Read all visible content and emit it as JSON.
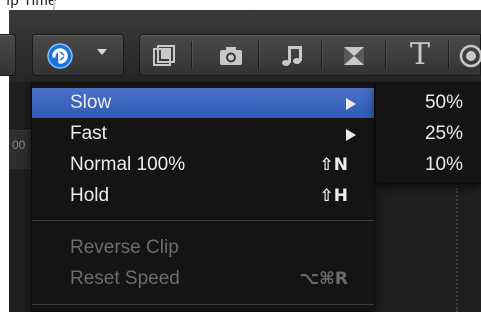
{
  "top_strip": {
    "partial_text": "ı̈p Time"
  },
  "timeline": {
    "ruler_text": "00"
  },
  "toolbar": {
    "retime_icon": "retime-speedometer-icon",
    "retime_dropdown_icon": "chevron-down-icon",
    "tools": [
      {
        "name": "video-filters-icon"
      },
      {
        "name": "photo-camera-icon"
      },
      {
        "name": "music-note-icon"
      },
      {
        "name": "transitions-icon"
      },
      {
        "name": "titles-icon",
        "glyph": "T"
      },
      {
        "name": "themes-icon"
      }
    ]
  },
  "retime_menu": {
    "items": [
      {
        "label": "Slow",
        "has_submenu": true,
        "selected": true,
        "enabled": true
      },
      {
        "label": "Fast",
        "has_submenu": true,
        "enabled": true
      },
      {
        "label": "Normal 100%",
        "shortcut": "⇧N",
        "enabled": true
      },
      {
        "label": "Hold",
        "shortcut": "⇧H",
        "enabled": true
      },
      {
        "label": "Reverse Clip",
        "enabled": false
      },
      {
        "label": "Reset Speed",
        "shortcut": "⌥⌘R",
        "enabled": false
      }
    ]
  },
  "slow_submenu": {
    "items": [
      {
        "label": "50%"
      },
      {
        "label": "25%"
      },
      {
        "label": "10%"
      }
    ]
  },
  "colors": {
    "selection": "#3a64c0",
    "menu_bg": "#141414",
    "text": "#ececec",
    "disabled_text": "#6c6c6c",
    "retime_icon_blue": "#2f8ef0"
  }
}
